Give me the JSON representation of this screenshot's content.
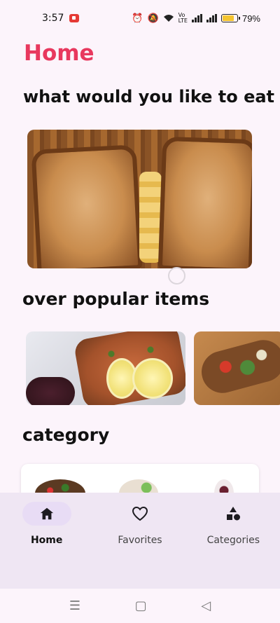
{
  "status_bar": {
    "time": "3:57",
    "battery_percent": "79%",
    "battery_level": 0.79,
    "icons": [
      "screen-record-icon",
      "alarm-icon",
      "mute-icon",
      "wifi-icon",
      "volte-icon",
      "signal-icon",
      "battery-icon"
    ]
  },
  "page": {
    "title": "Home",
    "title_color": "#e8385e"
  },
  "sections": {
    "eat_heading": "what would you like to eat",
    "popular_heading": "over popular items",
    "category_heading": "category"
  },
  "hero": {
    "image": "grilled-cheese-sandwich-image",
    "carousel_index": 0
  },
  "popular_items": [
    {
      "image": "salmon-with-lemon-image"
    },
    {
      "image": "tacos-image"
    }
  ],
  "categories": [
    {
      "image": "salad-bowl-image"
    },
    {
      "image": "plate-image"
    },
    {
      "image": "dessert-image"
    }
  ],
  "bottom_nav": {
    "items": [
      {
        "label": "Home",
        "icon": "home-icon",
        "active": true
      },
      {
        "label": "Favorites",
        "icon": "heart-icon",
        "active": false
      },
      {
        "label": "Categories",
        "icon": "shapes-icon",
        "active": false
      }
    ],
    "active_color": "#e8dcf5"
  },
  "system_nav": {
    "icons": [
      "recents-icon",
      "home-square-icon",
      "back-icon"
    ]
  }
}
